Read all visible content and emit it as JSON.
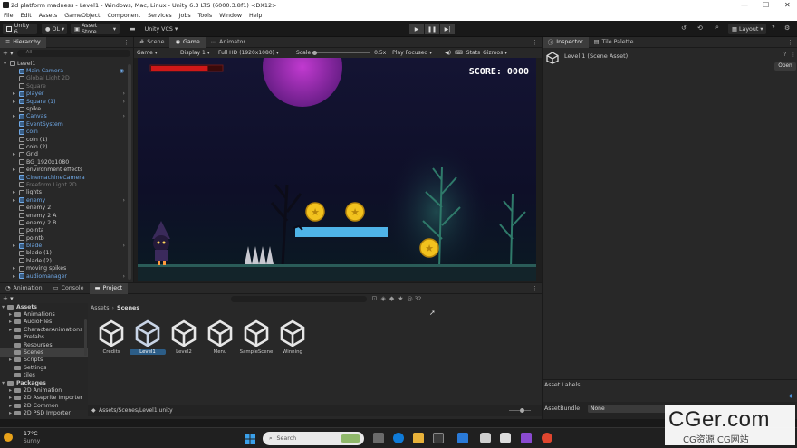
{
  "window": {
    "title": "2d platform madness - Level1 - Windows, Mac, Linux - Unity 6.3 LTS (6000.3.8f1) <DX12>",
    "minimize": "—",
    "maximize": "☐",
    "close": "✕"
  },
  "menu": [
    "File",
    "Edit",
    "Assets",
    "GameObject",
    "Component",
    "Services",
    "Jobs",
    "Tools",
    "Window",
    "Help"
  ],
  "toolbar": {
    "unity_label": "Unity 6",
    "account": "OL",
    "asset_store": "Asset Store",
    "vcs": "Unity VCS",
    "layout": "Layout"
  },
  "hierarchy": {
    "tab": "Hierarchy",
    "search_placeholder": "All",
    "items": [
      {
        "label": "Level1",
        "indent": 0,
        "style": "normal",
        "expand": "open"
      },
      {
        "label": "Main Camera",
        "indent": 1,
        "style": "blue",
        "expand": ""
      },
      {
        "label": "Global Light 2D",
        "indent": 1,
        "style": "dim",
        "expand": ""
      },
      {
        "label": "Square",
        "indent": 1,
        "style": "dim",
        "expand": ""
      },
      {
        "label": "player",
        "indent": 1,
        "style": "blue",
        "expand": "closed"
      },
      {
        "label": "Square (1)",
        "indent": 1,
        "style": "blue",
        "expand": "closed"
      },
      {
        "label": "spike",
        "indent": 1,
        "style": "normal",
        "expand": ""
      },
      {
        "label": "Canvas",
        "indent": 1,
        "style": "blue",
        "expand": "closed"
      },
      {
        "label": "EventSystem",
        "indent": 1,
        "style": "blue",
        "expand": ""
      },
      {
        "label": "coin",
        "indent": 1,
        "style": "blue",
        "expand": ""
      },
      {
        "label": "coin (1)",
        "indent": 1,
        "style": "normal",
        "expand": ""
      },
      {
        "label": "coin (2)",
        "indent": 1,
        "style": "normal",
        "expand": ""
      },
      {
        "label": "Grid",
        "indent": 1,
        "style": "normal",
        "expand": "closed"
      },
      {
        "label": "BG_1920x1080",
        "indent": 1,
        "style": "normal",
        "expand": ""
      },
      {
        "label": "environment effects",
        "indent": 1,
        "style": "normal",
        "expand": "closed"
      },
      {
        "label": "CinemachineCamera",
        "indent": 1,
        "style": "blue",
        "expand": ""
      },
      {
        "label": "Freeform Light 2D",
        "indent": 1,
        "style": "dim",
        "expand": ""
      },
      {
        "label": "lights",
        "indent": 1,
        "style": "normal",
        "expand": "closed"
      },
      {
        "label": "enemy",
        "indent": 1,
        "style": "blue",
        "expand": "closed"
      },
      {
        "label": "enemy 2",
        "indent": 1,
        "style": "normal",
        "expand": ""
      },
      {
        "label": "enemy 2 A",
        "indent": 1,
        "style": "normal",
        "expand": ""
      },
      {
        "label": "enemy 2 B",
        "indent": 1,
        "style": "normal",
        "expand": ""
      },
      {
        "label": "pointa",
        "indent": 1,
        "style": "normal",
        "expand": ""
      },
      {
        "label": "pointb",
        "indent": 1,
        "style": "normal",
        "expand": ""
      },
      {
        "label": "blade",
        "indent": 1,
        "style": "blue",
        "expand": "closed"
      },
      {
        "label": "blade (1)",
        "indent": 1,
        "style": "normal",
        "expand": ""
      },
      {
        "label": "blade (2)",
        "indent": 1,
        "style": "normal",
        "expand": ""
      },
      {
        "label": "moving spikes",
        "indent": 1,
        "style": "normal",
        "expand": "closed"
      },
      {
        "label": "audiomanager",
        "indent": 1,
        "style": "blue",
        "expand": "closed"
      }
    ]
  },
  "scene_tabs": [
    "Scene",
    "Game",
    "Animator"
  ],
  "game_bar": {
    "mode": "Game",
    "display": "Display 1",
    "resolution": "Full HD (1920x1080)",
    "scale_label": "Scale",
    "scale_value": "0.5x",
    "play_focused": "Play Focused",
    "stats": "Stats",
    "gizmos": "Gizmos"
  },
  "game": {
    "score": "SCORE: 0000",
    "health_fraction": 0.8
  },
  "inspector": {
    "tabs": [
      "Inspector",
      "Tile Palette"
    ],
    "title": "Level 1 (Scene Asset)",
    "open_button": "Open",
    "asset_labels": "Asset Labels",
    "asset_bundle_label": "AssetBundle",
    "asset_bundle_value": "None"
  },
  "bottom_tabs": [
    "Animation",
    "Console",
    "Project"
  ],
  "project": {
    "hidden_count": "32",
    "tree": [
      {
        "label": "Assets",
        "indent": 0,
        "bold": true
      },
      {
        "label": "Animations",
        "indent": 1
      },
      {
        "label": "AudioFiles",
        "indent": 1
      },
      {
        "label": "CharacterAnimations",
        "indent": 1
      },
      {
        "label": "Prefabs",
        "indent": 1
      },
      {
        "label": "Resourses",
        "indent": 1
      },
      {
        "label": "Scenes",
        "indent": 1,
        "selected": true
      },
      {
        "label": "Scripts",
        "indent": 1
      },
      {
        "label": "Settings",
        "indent": 1
      },
      {
        "label": "tiles",
        "indent": 1
      },
      {
        "label": "Packages",
        "indent": 0,
        "bold": true
      },
      {
        "label": "2D Animation",
        "indent": 1
      },
      {
        "label": "2D Aseprite Importer",
        "indent": 1
      },
      {
        "label": "2D Common",
        "indent": 1
      },
      {
        "label": "2D PSD Importer",
        "indent": 1
      }
    ],
    "breadcrumb": [
      "Assets",
      "Scenes"
    ],
    "assets": [
      {
        "name": "Credits",
        "selected": false
      },
      {
        "name": "Level1",
        "selected": true
      },
      {
        "name": "Level2",
        "selected": false
      },
      {
        "name": "Menu",
        "selected": false
      },
      {
        "name": "SampleScene",
        "selected": false
      },
      {
        "name": "Winning",
        "selected": false
      }
    ],
    "footer_path": "Assets/Scenes/Level1.unity"
  },
  "taskbar": {
    "weather_temp": "17°C",
    "weather_desc": "Sunny",
    "search_placeholder": "Search"
  },
  "watermark": {
    "main": "CGer.com",
    "sub": "CG资源 CG网站"
  }
}
